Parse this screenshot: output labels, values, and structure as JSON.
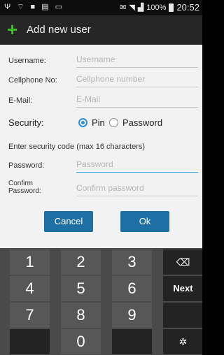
{
  "status_bar": {
    "left_icons": [
      "usb-icon",
      "android-icon",
      "lock-icon",
      "screenshot-icon",
      "image-icon"
    ],
    "right_icons": [
      "mail-icon",
      "wifi-icon",
      "signal-icon"
    ],
    "battery": "100%",
    "time": "20:52"
  },
  "action_bar": {
    "title": "Add new user",
    "icon": "plus-icon",
    "icon_color": "#3fbf2a"
  },
  "form": {
    "username": {
      "label": "Username:",
      "placeholder": "Username"
    },
    "cellphone": {
      "label": "Cellphone No:",
      "placeholder": "Cellphone number"
    },
    "email": {
      "label": "E-Mail:",
      "placeholder": "E-Mail"
    },
    "security": {
      "label": "Security:",
      "options": [
        {
          "label": "Pin",
          "selected": true
        },
        {
          "label": "Password",
          "selected": false
        }
      ]
    },
    "hint": "Enter security code (max 16 characters)",
    "password": {
      "label": "Password:",
      "placeholder": "Password"
    },
    "confirm": {
      "label_line1": "Confirm",
      "label_line2": "Password:",
      "placeholder": "Confirm password"
    }
  },
  "buttons": {
    "cancel": "Cancel",
    "ok": "Ok",
    "color": "#1e6fa3"
  },
  "keyboard": {
    "rows": [
      [
        "1",
        "2",
        "3",
        "⌫"
      ],
      [
        "4",
        "5",
        "6",
        "Next"
      ],
      [
        "7",
        "8",
        "9",
        ""
      ],
      [
        "",
        "0",
        "",
        "✲"
      ]
    ]
  }
}
